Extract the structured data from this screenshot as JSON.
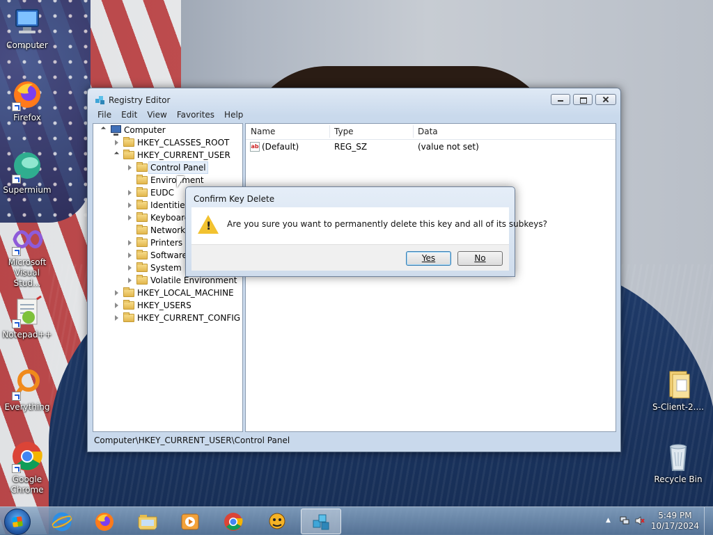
{
  "desktop": {
    "icons": [
      {
        "label": "Computer",
        "icon": "computer-icon"
      },
      {
        "label": "Firefox",
        "icon": "firefox-icon"
      },
      {
        "label": "Supermium",
        "icon": "supermium-icon"
      },
      {
        "label": "Microsoft Visual Stud...",
        "icon": "visual-studio-icon"
      },
      {
        "label": "Notepad++",
        "icon": "notepadpp-icon"
      },
      {
        "label": "Everything",
        "icon": "everything-icon"
      },
      {
        "label": "Google Chrome",
        "icon": "chrome-icon"
      },
      {
        "label": "S-Client-2....",
        "icon": "folder-icon"
      },
      {
        "label": "Recycle Bin",
        "icon": "recycle-bin-icon"
      }
    ]
  },
  "window": {
    "title": "Registry Editor",
    "menu": [
      "File",
      "Edit",
      "View",
      "Favorites",
      "Help"
    ],
    "tree": {
      "root": "Computer",
      "hives": [
        "HKEY_CLASSES_ROOT",
        "HKEY_CURRENT_USER",
        "HKEY_LOCAL_MACHINE",
        "HKEY_USERS",
        "HKEY_CURRENT_CONFIG"
      ],
      "current_user_children": [
        "Control Panel",
        "Environment",
        "EUDC",
        "Identities",
        "Keyboard",
        "Network",
        "Printers",
        "Software",
        "System",
        "Volatile Environment"
      ]
    },
    "list": {
      "columns": [
        "Name",
        "Type",
        "Data"
      ],
      "rows": [
        {
          "name": "(Default)",
          "type": "REG_SZ",
          "data": "(value not set)"
        }
      ]
    },
    "status_path": "Computer\\HKEY_CURRENT_USER\\Control Panel"
  },
  "dialog": {
    "title": "Confirm Key Delete",
    "message": "Are you sure you want to permanently delete this key and all of its subkeys?",
    "yes_label": "Yes",
    "no_label": "No"
  },
  "taskbar": {
    "apps": [
      "internet-explorer-icon",
      "firefox-icon",
      "file-explorer-icon",
      "media-player-icon",
      "chrome-icon",
      "app-icon",
      "registry-editor-icon"
    ],
    "time": "5:49 PM",
    "date": "10/17/2024"
  }
}
